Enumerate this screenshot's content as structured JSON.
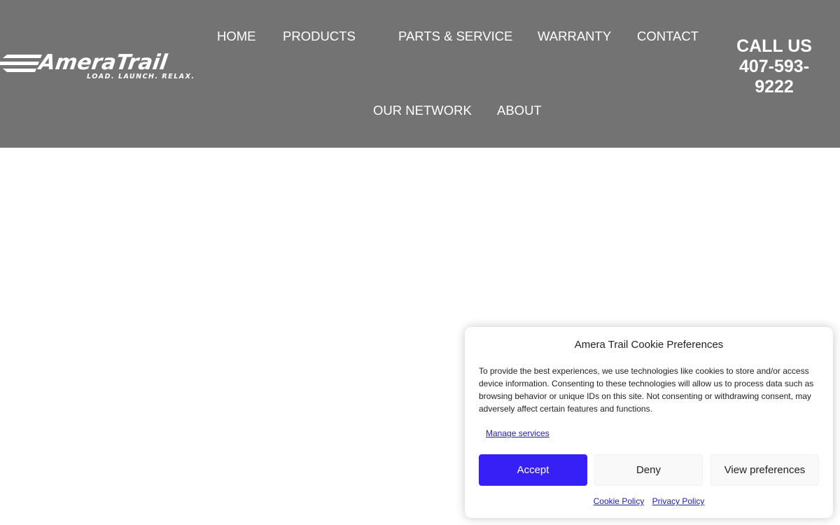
{
  "brand": {
    "name": "AmeraTrail",
    "tagline": "LOAD. LAUNCH. RELAX."
  },
  "nav": {
    "home": "HOME",
    "products": "PRODUCTS",
    "parts_service": "PARTS & SERVICE",
    "warranty": "WARRANTY",
    "contact": "CONTACT",
    "our_network": "OUR NETWORK",
    "about": "ABOUT"
  },
  "call": {
    "label": "CALL US",
    "phone_line1": "407-593-",
    "phone_line2": "9222"
  },
  "cookie": {
    "title": "Amera Trail Cookie Preferences",
    "message": "To provide the best experiences, we use technologies like cookies to store and/or access device information. Consenting to these technologies will allow us to process data such as browsing behavior or unique IDs on this site. Not consenting or withdrawing consent, may adversely affect certain features and functions.",
    "manage_services": "Manage services",
    "accept": "Accept",
    "deny": "Deny",
    "view_preferences": "View preferences",
    "cookie_policy": "Cookie Policy",
    "privacy_policy": "Privacy Policy"
  },
  "colors": {
    "header_bg": "#737373",
    "accept_bg": "#3720f5",
    "link": "#1e22aa"
  }
}
